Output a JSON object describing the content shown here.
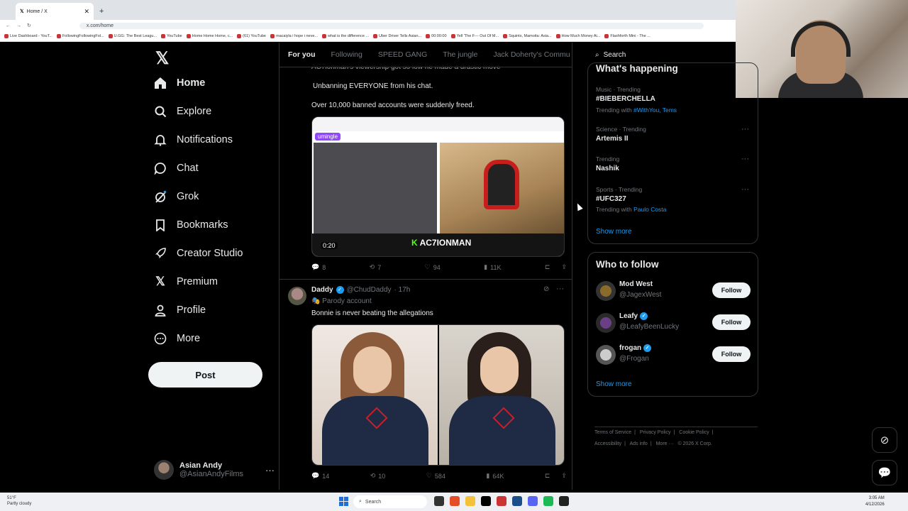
{
  "browser": {
    "tab_title": "Home / X",
    "url": "x.com/home",
    "bookmarks": [
      "Live Dashboard - YouT...",
      "FollowingFollowingFol...",
      "U.GG: The Best Leagu...",
      "YouTube",
      "Home Home Home, c...",
      "(61) YouTube",
      "macaiyla i hope i neve...",
      "what is the difference ...",
      "Uber Driver Tells Asian...",
      "00:00:00",
      "Yell 'The F--- Out Of M...",
      "Squints, Mamoita: Asia...",
      "How Much Money Ai...",
      "Flashforth Mini - The ..."
    ]
  },
  "nav": {
    "items": [
      {
        "label": "Home",
        "icon": "home-icon"
      },
      {
        "label": "Explore",
        "icon": "search-icon"
      },
      {
        "label": "Notifications",
        "icon": "bell-icon"
      },
      {
        "label": "Chat",
        "icon": "chat-icon"
      },
      {
        "label": "Grok",
        "icon": "grok-icon"
      },
      {
        "label": "Bookmarks",
        "icon": "bookmark-icon"
      },
      {
        "label": "Creator Studio",
        "icon": "rocket-icon"
      },
      {
        "label": "Premium",
        "icon": "x-icon"
      },
      {
        "label": "Profile",
        "icon": "person-icon"
      },
      {
        "label": "More",
        "icon": "more-circle-icon"
      }
    ],
    "post_label": "Post",
    "account": {
      "name": "Asian Andy",
      "handle": "@AsianAndyFilms"
    }
  },
  "feed": {
    "tabs": [
      "For you",
      "Following",
      "SPEED GANG",
      "The jungle",
      "Jack Doherty's Commu"
    ],
    "post1": {
      "partial_text": "AC7ionman's viewership got so low he made a drastic move",
      "line1": "Unbanning EVERYONE from his chat.",
      "line2": "Over 10,000 banned accounts were suddenly freed.",
      "media_brand": "umingle",
      "media_watermark": "AC7IONMAN",
      "media_watermark_k": "K",
      "media_time": "0:20",
      "replies": "8",
      "reposts": "7",
      "likes": "94",
      "views": "11K"
    },
    "post2": {
      "name": "Daddy",
      "handle": "@ChudDaddy",
      "time": "· 17h",
      "parody": "Parody account",
      "text": "Bonnie is never beating the allegations",
      "replies": "14",
      "reposts": "10",
      "likes": "584",
      "views": "64K"
    }
  },
  "right": {
    "search_placeholder": "Search",
    "happening_title": "What's happening",
    "trends": [
      {
        "meta": "Music · Trending",
        "tag": "#BIEBERCHELLA",
        "with_label": "Trending with",
        "with": "#WithYou, Tems"
      },
      {
        "meta": "Science · Trending",
        "tag": "Artemis II"
      },
      {
        "meta": "Trending",
        "tag": "Nashik"
      },
      {
        "meta": "Sports · Trending",
        "tag": "#UFC327",
        "with_label": "Trending with",
        "with": "Paulo Costa"
      }
    ],
    "show_more": "Show more",
    "wtf_title": "Who to follow",
    "wtf": [
      {
        "name": "Mod West",
        "handle": "@JagexWest",
        "verified": false
      },
      {
        "name": "Leafy",
        "handle": "@LeafyBeenLucky",
        "verified": true
      },
      {
        "name": "frogan",
        "handle": "@Frogan",
        "verified": true
      }
    ],
    "follow_label": "Follow",
    "footer": [
      "Terms of Service",
      "|",
      "Privacy Policy",
      "|",
      "Cookie Policy",
      "|",
      "Accessibility",
      "|",
      "Ads info",
      "|",
      "More ···",
      "© 2026 X Corp."
    ]
  },
  "taskbar": {
    "weather_temp": "51°F",
    "weather_desc": "Partly cloudy",
    "search": "Search",
    "time": "3:05 AM",
    "date": "4/12/2026"
  },
  "colors": {
    "accent": "#1d9bf0",
    "bg": "#000000",
    "border": "#2f3336"
  }
}
